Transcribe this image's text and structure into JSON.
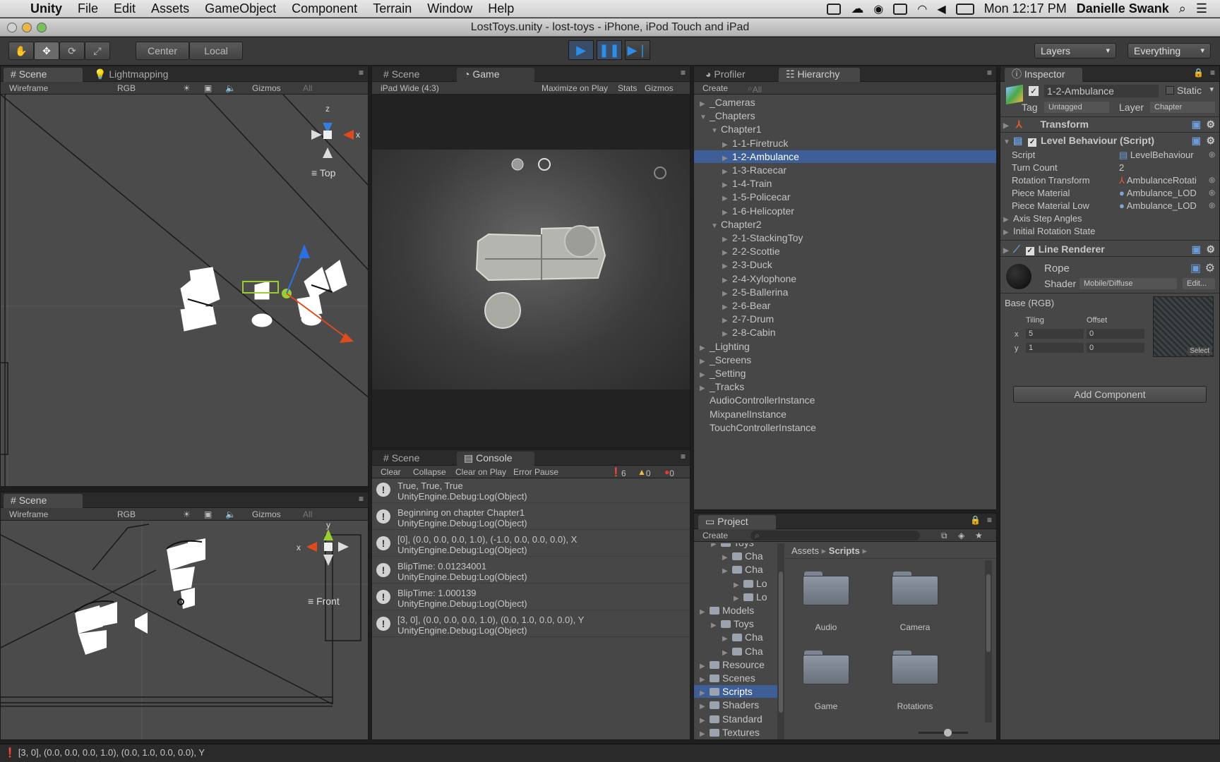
{
  "menubar": {
    "app": "Unity",
    "items": [
      "File",
      "Edit",
      "Assets",
      "GameObject",
      "Component",
      "Terrain",
      "Window",
      "Help"
    ],
    "clock": "Mon 12:17 PM",
    "user": "Danielle Swank"
  },
  "window": {
    "title": "LostToys.unity - lost-toys - iPhone, iPod Touch and iPad"
  },
  "toolbar": {
    "pivot": "Center",
    "space": "Local",
    "layers": "Layers",
    "layout": "Everything"
  },
  "scene_top": {
    "tabs": [
      "Scene",
      "Lightmapping"
    ],
    "render_mode": "Wireframe",
    "color_mode": "RGB",
    "gizmos": "Gizmos",
    "search": "All",
    "view_label": "Top",
    "axis_z": "z",
    "axis_x": "x"
  },
  "scene_bottom": {
    "tab": "Scene",
    "render_mode": "Wireframe",
    "color_mode": "RGB",
    "gizmos": "Gizmos",
    "search": "All",
    "view_label": "Front",
    "axis_y": "y",
    "axis_x": "x"
  },
  "game": {
    "tabs": [
      "Scene",
      "Game"
    ],
    "aspect": "iPad Wide (4:3)",
    "maximize": "Maximize on Play",
    "stats": "Stats",
    "gizmos": "Gizmos"
  },
  "console": {
    "tabs": [
      "Scene",
      "Console"
    ],
    "buttons": [
      "Clear",
      "Collapse",
      "Clear on Play",
      "Error Pause"
    ],
    "counts": {
      "log": "6",
      "warn": "0",
      "error": "0"
    },
    "logs": [
      {
        "line1": "True, True, True",
        "line2": "UnityEngine.Debug:Log(Object)"
      },
      {
        "line1": "Beginning on chapter Chapter1",
        "line2": "UnityEngine.Debug:Log(Object)"
      },
      {
        "line1": "[0], (0.0, 0.0, 0.0, 1.0), (-1.0, 0.0, 0.0, 0.0), X",
        "line2": "UnityEngine.Debug:Log(Object)"
      },
      {
        "line1": "BlipTime: 0.01234001",
        "line2": "UnityEngine.Debug:Log(Object)"
      },
      {
        "line1": "BlipTime: 1.000139",
        "line2": "UnityEngine.Debug:Log(Object)"
      },
      {
        "line1": "[3, 0], (0.0, 0.0, 0.0, 1.0), (0.0, 1.0, 0.0, 0.0), Y",
        "line2": "UnityEngine.Debug:Log(Object)"
      }
    ]
  },
  "hierarchy": {
    "tabs": [
      "Profiler",
      "Hierarchy"
    ],
    "create": "Create",
    "search": "All",
    "items": [
      {
        "label": "_Cameras",
        "depth": 0,
        "open": false
      },
      {
        "label": "_Chapters",
        "depth": 0,
        "open": true
      },
      {
        "label": "Chapter1",
        "depth": 1,
        "open": true
      },
      {
        "label": "1-1-Firetruck",
        "depth": 2,
        "open": false
      },
      {
        "label": "1-2-Ambulance",
        "depth": 2,
        "open": false,
        "selected": true
      },
      {
        "label": "1-3-Racecar",
        "depth": 2,
        "open": false
      },
      {
        "label": "1-4-Train",
        "depth": 2,
        "open": false
      },
      {
        "label": "1-5-Policecar",
        "depth": 2,
        "open": false
      },
      {
        "label": "1-6-Helicopter",
        "depth": 2,
        "open": false
      },
      {
        "label": "Chapter2",
        "depth": 1,
        "open": true
      },
      {
        "label": "2-1-StackingToy",
        "depth": 2,
        "open": false
      },
      {
        "label": "2-2-Scottie",
        "depth": 2,
        "open": false
      },
      {
        "label": "2-3-Duck",
        "depth": 2,
        "open": false
      },
      {
        "label": "2-4-Xylophone",
        "depth": 2,
        "open": false
      },
      {
        "label": "2-5-Ballerina",
        "depth": 2,
        "open": false
      },
      {
        "label": "2-6-Bear",
        "depth": 2,
        "open": false
      },
      {
        "label": "2-7-Drum",
        "depth": 2,
        "open": false
      },
      {
        "label": "2-8-Cabin",
        "depth": 2,
        "open": false
      },
      {
        "label": "_Lighting",
        "depth": 0,
        "open": false
      },
      {
        "label": "_Screens",
        "depth": 0,
        "open": false
      },
      {
        "label": "_Setting",
        "depth": 0,
        "open": false
      },
      {
        "label": "_Tracks",
        "depth": 0,
        "open": false
      },
      {
        "label": "AudioControllerInstance",
        "depth": 0,
        "leaf": true
      },
      {
        "label": "MixpanelInstance",
        "depth": 0,
        "leaf": true
      },
      {
        "label": "TouchControllerInstance",
        "depth": 0,
        "leaf": true
      }
    ]
  },
  "project": {
    "tab": "Project",
    "create": "Create",
    "breadcrumb": [
      "Assets",
      "Scripts"
    ],
    "tree": [
      {
        "label": "Toys",
        "depth": 2
      },
      {
        "label": "Cha",
        "depth": 3
      },
      {
        "label": "Cha",
        "depth": 3
      },
      {
        "label": "Lo",
        "depth": 4
      },
      {
        "label": "Lo",
        "depth": 4
      },
      {
        "label": "Models",
        "depth": 1
      },
      {
        "label": "Toys",
        "depth": 2
      },
      {
        "label": "Cha",
        "depth": 3
      },
      {
        "label": "Cha",
        "depth": 3
      },
      {
        "label": "Resource",
        "depth": 1
      },
      {
        "label": "Scenes",
        "depth": 1
      },
      {
        "label": "Scripts",
        "depth": 1,
        "selected": true
      },
      {
        "label": "Shaders",
        "depth": 1
      },
      {
        "label": "Standard",
        "depth": 1
      },
      {
        "label": "Textures",
        "depth": 1
      }
    ],
    "folders": [
      "Audio",
      "Camera",
      "Game",
      "Rotations"
    ]
  },
  "inspector": {
    "tab": "Inspector",
    "object_name": "1-2-Ambulance",
    "static": "Static",
    "tag_label": "Tag",
    "tag": "Untagged",
    "layer_label": "Layer",
    "layer": "Chapter",
    "transform": "Transform",
    "script_component": "Level Behaviour (Script)",
    "fields": [
      {
        "label": "Script",
        "value": "LevelBehaviour"
      },
      {
        "label": "Turn Count",
        "value": "2"
      },
      {
        "label": "Rotation Transform",
        "value": "AmbulanceRotati"
      },
      {
        "label": "Piece Material",
        "value": "Ambulance_LOD"
      },
      {
        "label": "Piece Material Low",
        "value": "Ambulance_LOD"
      }
    ],
    "foldouts": [
      "Axis Step Angles",
      "Initial Rotation State"
    ],
    "line_renderer": "Line Renderer",
    "material": "Rope",
    "shader_label": "Shader",
    "shader": "Mobile/Diffuse",
    "edit": "Edit...",
    "base": "Base (RGB)",
    "tiling": "Tiling",
    "offset": "Offset",
    "x_label": "x",
    "y_label": "y",
    "tiling_x": "5",
    "tiling_y": "1",
    "offset_x": "0",
    "offset_y": "0",
    "select": "Select",
    "add_component": "Add Component"
  },
  "status": {
    "text": "[3, 0], (0.0, 0.0, 0.0, 1.0), (0.0, 1.0, 0.0, 0.0), Y"
  }
}
